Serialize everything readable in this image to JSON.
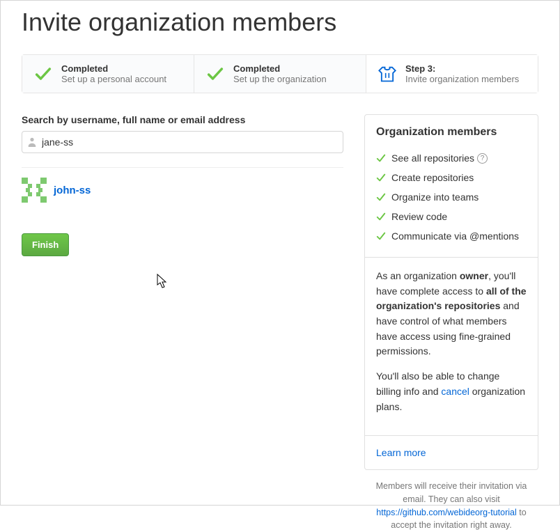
{
  "page_title": "Invite organization members",
  "steps": [
    {
      "title": "Completed",
      "sub": "Set up a personal account",
      "type": "done"
    },
    {
      "title": "Completed",
      "sub": "Set up the organization",
      "type": "done"
    },
    {
      "title": "Step 3:",
      "sub": "Invite organization members",
      "type": "active"
    }
  ],
  "search": {
    "label": "Search by username, full name or email address",
    "value": "jane-ss"
  },
  "member": {
    "name": "john-ss"
  },
  "finish_label": "Finish",
  "sidebar": {
    "heading": "Organization members",
    "perks": [
      "See all repositories",
      "Create repositories",
      "Organize into teams",
      "Review code",
      "Communicate via @mentions"
    ],
    "owner_p1_a": "As an organization ",
    "owner_p1_b": "owner",
    "owner_p1_c": ", you'll have complete access to ",
    "owner_p1_d": "all of the organization's repositories",
    "owner_p1_e": " and have control of what members have access using fine-grained permissions.",
    "owner_p2_a": "You'll also be able to change billing info and ",
    "owner_p2_b": "cancel",
    "owner_p2_c": " organization plans.",
    "learn_more": "Learn more"
  },
  "footer": {
    "line1": "Members will receive their invitation via email. They can also visit ",
    "link": "https://github.com/webideorg-tutorial",
    "line2": " to accept the invitation right away."
  }
}
